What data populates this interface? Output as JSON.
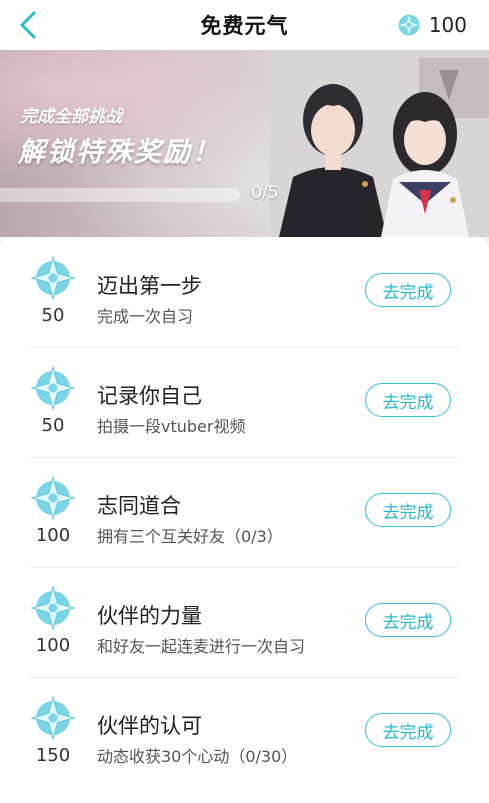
{
  "header": {
    "title": "免费元气",
    "balance": "100"
  },
  "banner": {
    "subtitle": "完成全部挑战",
    "headline": "解锁特殊奖励！",
    "progress_text": "0/5",
    "progress_fraction": 0
  },
  "tasks": [
    {
      "points": "50",
      "title": "迈出第一步",
      "desc": "完成一次自习",
      "button": "去完成"
    },
    {
      "points": "50",
      "title": "记录你自己",
      "desc": "拍摄一段vtuber视频",
      "button": "去完成"
    },
    {
      "points": "100",
      "title": "志同道合",
      "desc": "拥有三个互关好友（0/3）",
      "button": "去完成"
    },
    {
      "points": "100",
      "title": "伙伴的力量",
      "desc": "和好友一起连麦进行一次自习",
      "button": "去完成"
    },
    {
      "points": "150",
      "title": "伙伴的认可",
      "desc": "动态收获30个心动（0/30）",
      "button": "去完成"
    }
  ],
  "colors": {
    "accent": "#34c2d9",
    "gem": "#6fd3e6"
  },
  "icons": {
    "back": "chevron-left-icon",
    "gem": "energy-gem-icon"
  }
}
